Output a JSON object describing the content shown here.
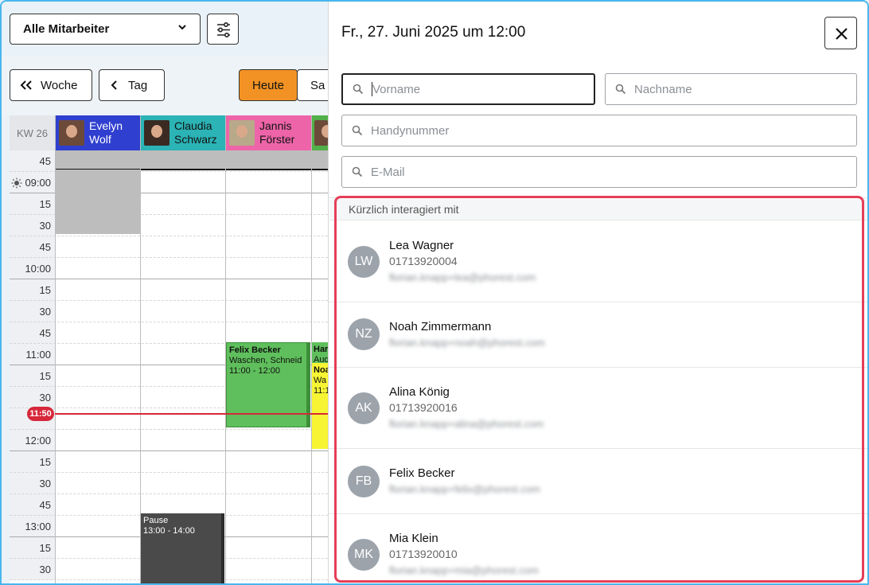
{
  "toolbar": {
    "staff_select": "Alle Mitarbeiter",
    "btn_week": "Woche",
    "btn_day": "Tag",
    "btn_today": "Heute",
    "btn_sa": "Sa"
  },
  "calendar": {
    "kw": "KW 26",
    "columns": [
      {
        "name1": "Evelyn",
        "name2": "Wolf",
        "color": "#2f3fcf"
      },
      {
        "name1": "Claudia",
        "name2": "Schwarz",
        "color": "#2bb3b5"
      },
      {
        "name1": "Jannis",
        "name2": "Förster",
        "color": "#ee64a9"
      },
      {
        "name1": "",
        "name2": "",
        "color": "#52b049"
      }
    ],
    "times": [
      "45",
      "09:00",
      "15",
      "30",
      "45",
      "10:00",
      "15",
      "30",
      "45",
      "11:00",
      "15",
      "30",
      "",
      "12:00",
      "15",
      "30",
      "45",
      "13:00",
      "15",
      "30"
    ],
    "now": "11:50",
    "events": [
      {
        "title": "Felix Becker",
        "service": "Waschen, Schneid",
        "time": "11:00 - 12:00",
        "color": "#5fbf5c"
      },
      {
        "title": "Har",
        "service": "Aug",
        "time": "",
        "color": "#5fbf5c"
      },
      {
        "title": "Noa",
        "service": "Wa",
        "time": "11:1",
        "color": "#f7f533"
      },
      {
        "title": "Pause",
        "service": "13:00 - 14:00",
        "time": "",
        "color": "#4a4a4a"
      }
    ]
  },
  "panel": {
    "title": "Fr., 27. Juni 2025 um 12:00",
    "fields": {
      "firstname": "Vorname",
      "lastname": "Nachname",
      "phone": "Handynummer",
      "email": "E-Mail"
    },
    "section": "Kürzlich interagiert mit",
    "contacts": [
      {
        "initials": "LW",
        "name": "Lea Wagner",
        "phone": "01713920004",
        "email": "florian.knapp+lea@phorest.com"
      },
      {
        "initials": "NZ",
        "name": "Noah Zimmermann",
        "phone": "",
        "email": "florian.knapp+noah@phorest.com"
      },
      {
        "initials": "AK",
        "name": "Alina König",
        "phone": "01713920016",
        "email": "florian.knapp+alina@phorest.com"
      },
      {
        "initials": "FB",
        "name": "Felix Becker",
        "phone": "",
        "email": "florian.knapp+felix@phorest.com"
      },
      {
        "initials": "MK",
        "name": "Mia Klein",
        "phone": "01713920010",
        "email": "florian.knapp+mia@phorest.com"
      }
    ]
  }
}
